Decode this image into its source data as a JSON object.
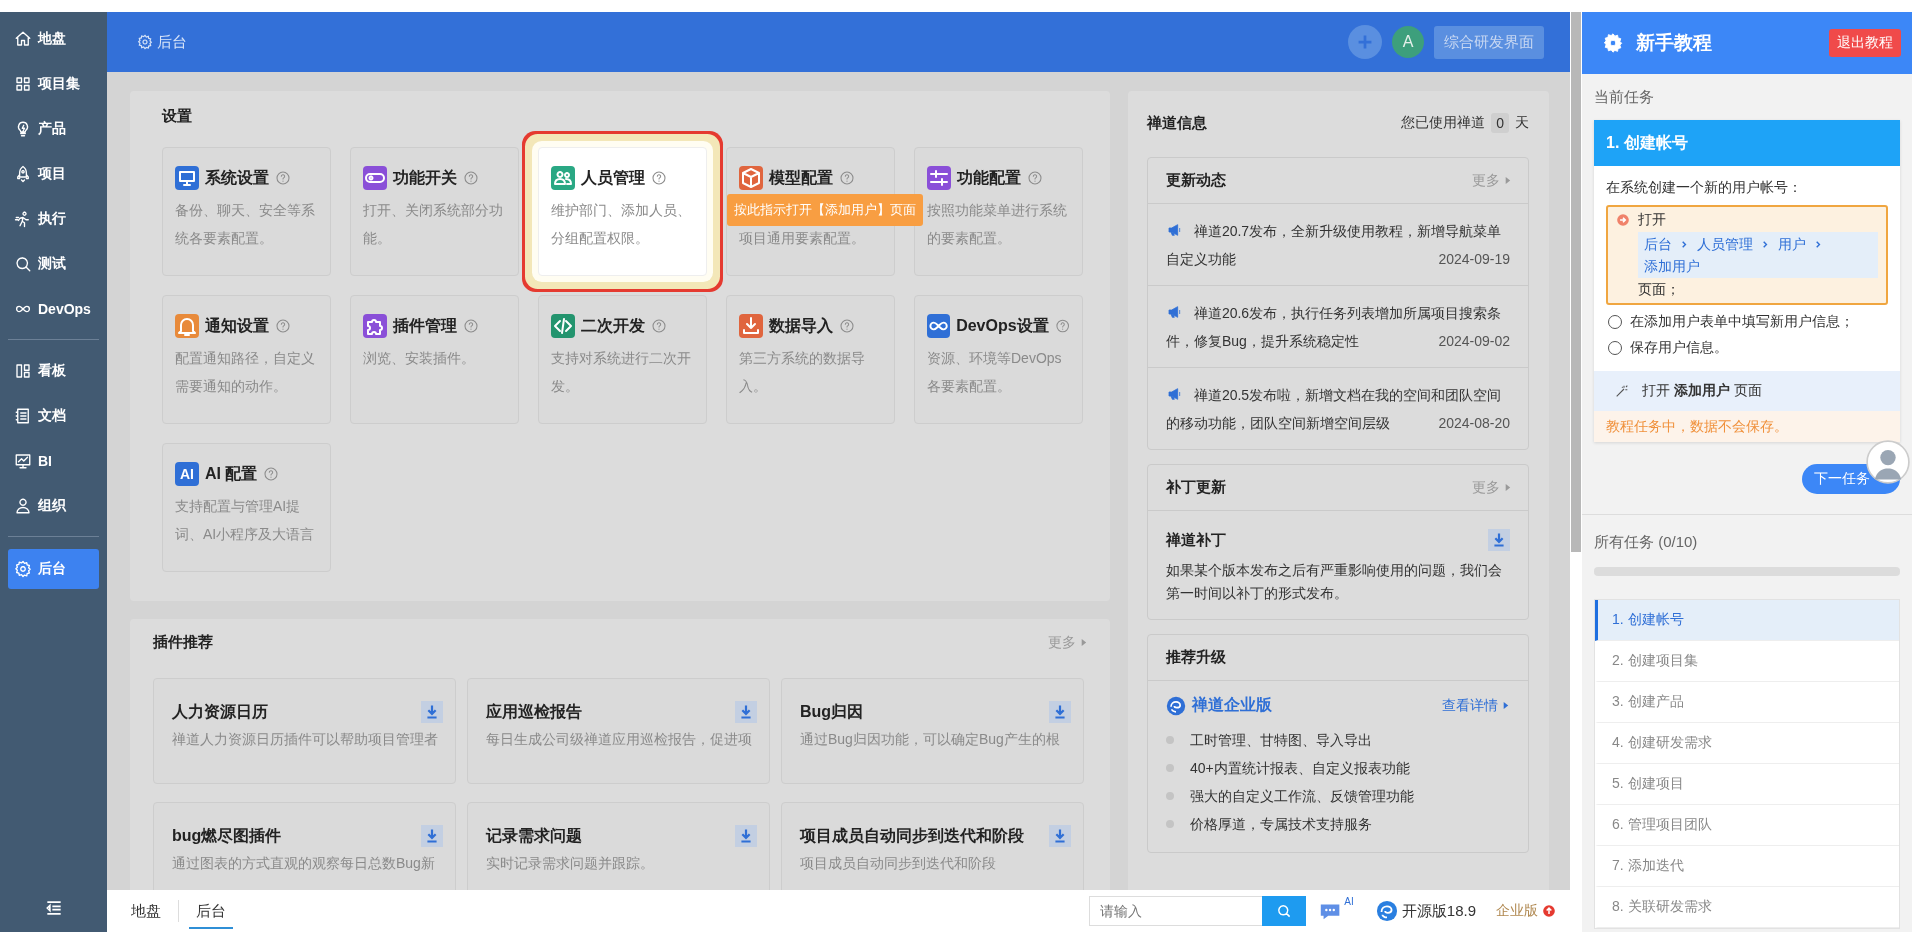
{
  "sidebar": {
    "groups": [
      {
        "items": [
          {
            "label": "地盘",
            "selected": false
          },
          {
            "label": "项目集",
            "selected": false
          },
          {
            "label": "产品",
            "selected": false
          },
          {
            "label": "项目",
            "selected": false
          },
          {
            "label": "执行",
            "selected": false
          },
          {
            "label": "测试",
            "selected": false
          },
          {
            "label": "DevOps",
            "selected": false
          }
        ]
      },
      {
        "items": [
          {
            "label": "看板",
            "selected": false
          },
          {
            "label": "文档",
            "selected": false
          },
          {
            "label": "BI",
            "selected": false
          },
          {
            "label": "组织",
            "selected": false
          }
        ]
      },
      {
        "items": [
          {
            "label": "后台",
            "selected": true
          }
        ]
      }
    ]
  },
  "header": {
    "breadcrumb": "后台",
    "avatar": "A",
    "switch_button": "综合研发界面"
  },
  "settings": {
    "title": "设置",
    "tour_tip": "按此指示打开【添加用户】页面",
    "cards": [
      {
        "title": "系统设置",
        "description": "备份、聊天、安全等系统各要素配置。",
        "color": "#2f6fd6",
        "highlighted": false,
        "covered": false
      },
      {
        "title": "功能开关",
        "description": "打开、关闭系统部分功能。",
        "color": "#8a4fd8",
        "highlighted": false,
        "covered": false
      },
      {
        "title": "人员管理",
        "description": "维护部门、添加人员、分组配置权限。",
        "color": "#2aa884",
        "highlighted": true,
        "covered": false
      },
      {
        "title": "模型配置",
        "description": "项目通用要素配置。",
        "color": "#e0653e",
        "highlighted": false,
        "covered": true
      },
      {
        "title": "功能配置",
        "description": "按照功能菜单进行系统的要素配置。",
        "color": "#8a4fd8",
        "highlighted": false,
        "covered": false
      },
      {
        "title": "通知设置",
        "description": "配置通知路径，自定义需要通知的动作。",
        "color": "#e88a3a",
        "highlighted": false,
        "covered": false
      },
      {
        "title": "插件管理",
        "description": "浏览、安装插件。",
        "color": "#8a4fd8",
        "highlighted": false,
        "covered": false
      },
      {
        "title": "二次开发",
        "description": "支持对系统进行二次开发。",
        "color": "#23946e",
        "highlighted": false,
        "covered": false
      },
      {
        "title": "数据导入",
        "description": "第三方系统的数据导入。",
        "color": "#e0653e",
        "highlighted": false,
        "covered": false
      },
      {
        "title": "DevOps设置",
        "description": "资源、环境等DevOps各要素配置。",
        "color": "#2f6fd6",
        "highlighted": false,
        "covered": false
      },
      {
        "title": "AI 配置",
        "description": "支持配置与管理AI提词、AI小程序及大语言",
        "color": "#2f6fd6",
        "highlighted": false,
        "covered": false,
        "icon_text": "AI"
      }
    ]
  },
  "plugins": {
    "title": "插件推荐",
    "more": "更多",
    "cards": [
      {
        "title": "人力资源日历",
        "description": "禅道人力资源日历插件可以帮助项目管理者"
      },
      {
        "title": "应用巡检报告",
        "description": "每日生成公司级禅道应用巡检报告，促进项"
      },
      {
        "title": "Bug归因",
        "description": "通过Bug归因功能，可以确定Bug产生的根"
      },
      {
        "title": "bug燃尽图插件",
        "description": "通过图表的方式直观的观察每日总数Bug新"
      },
      {
        "title": "记录需求问题",
        "description": "实时记录需求问题并跟踪。"
      },
      {
        "title": "项目成员自动同步到迭代和阶段",
        "description": "项目成员自动同步到迭代和阶段"
      }
    ]
  },
  "info": {
    "title": "禅道信息",
    "usage_prefix": "您已使用禅道",
    "usage_days": "0",
    "usage_suffix": "天",
    "updates": {
      "title": "更新动态",
      "more": "更多",
      "items": [
        {
          "text": "禅道20.7发布，全新升级使用教程，新增导航菜单自定义功能",
          "date": "2024-09-19"
        },
        {
          "text": "禅道20.6发布，执行任务列表增加所属项目搜索条件，修复Bug，提升系统稳定性",
          "date": "2024-09-02"
        },
        {
          "text": "禅道20.5发布啦，新增文档在我的空间和团队空间的移动功能，团队空间新增空间层级",
          "date": "2024-08-20"
        }
      ]
    },
    "patch": {
      "title": "补丁更新",
      "more": "更多",
      "name": "禅道补丁",
      "description": "如果某个版本发布之后有严重影响使用的问题，我们会第一时间以补丁的形式发布。"
    },
    "upgrade": {
      "title": "推荐升级",
      "product": "禅道企业版",
      "details": "查看详情",
      "features": [
        "工时管理、甘特图、导入导出",
        "40+内置统计报表、自定义报表功能",
        "强大的自定义工作流、反馈管理功能",
        "价格厚道，专属技术支持服务"
      ]
    }
  },
  "bottom_bar": {
    "tabs": [
      {
        "label": "地盘",
        "selected": false
      },
      {
        "label": "后台",
        "selected": true
      }
    ],
    "search": {
      "placeholder": "请输入"
    },
    "ai_badge": "AI",
    "version": "开源版18.9",
    "enterprise": "企业版"
  },
  "tutorial": {
    "title": "新手教程",
    "exit_button": "退出教程",
    "current_label": "当前任务",
    "task": {
      "title": "1. 创建帐号",
      "intro": "在系统创建一个新的用户帐号：",
      "steps": [
        {
          "text": "打开",
          "path": [
            "后台",
            "人员管理",
            "用户",
            "添加用户"
          ],
          "suffix": "页面；",
          "current": true
        },
        {
          "text": "在添加用户表单中填写新用户信息；",
          "current": false
        },
        {
          "text": "保存用户信息。",
          "current": false
        }
      ],
      "action": "打开 **添加用户** 页面",
      "warning": "教程任务中，数据不会保存。"
    },
    "next_button": "下一任务",
    "all_label": "所有任务 (0/10)",
    "progress": {
      "level": 0
    },
    "tasks": [
      {
        "label": "1. 创建帐号",
        "selected": true
      },
      {
        "label": "2. 创建项目集",
        "selected": false
      },
      {
        "label": "3. 创建产品",
        "selected": false
      },
      {
        "label": "4. 创建研发需求",
        "selected": false
      },
      {
        "label": "5. 创建项目",
        "selected": false
      },
      {
        "label": "6. 管理项目团队",
        "selected": false
      },
      {
        "label": "7. 添加迭代",
        "selected": false
      },
      {
        "label": "8. 关联研发需求",
        "selected": false
      }
    ]
  }
}
